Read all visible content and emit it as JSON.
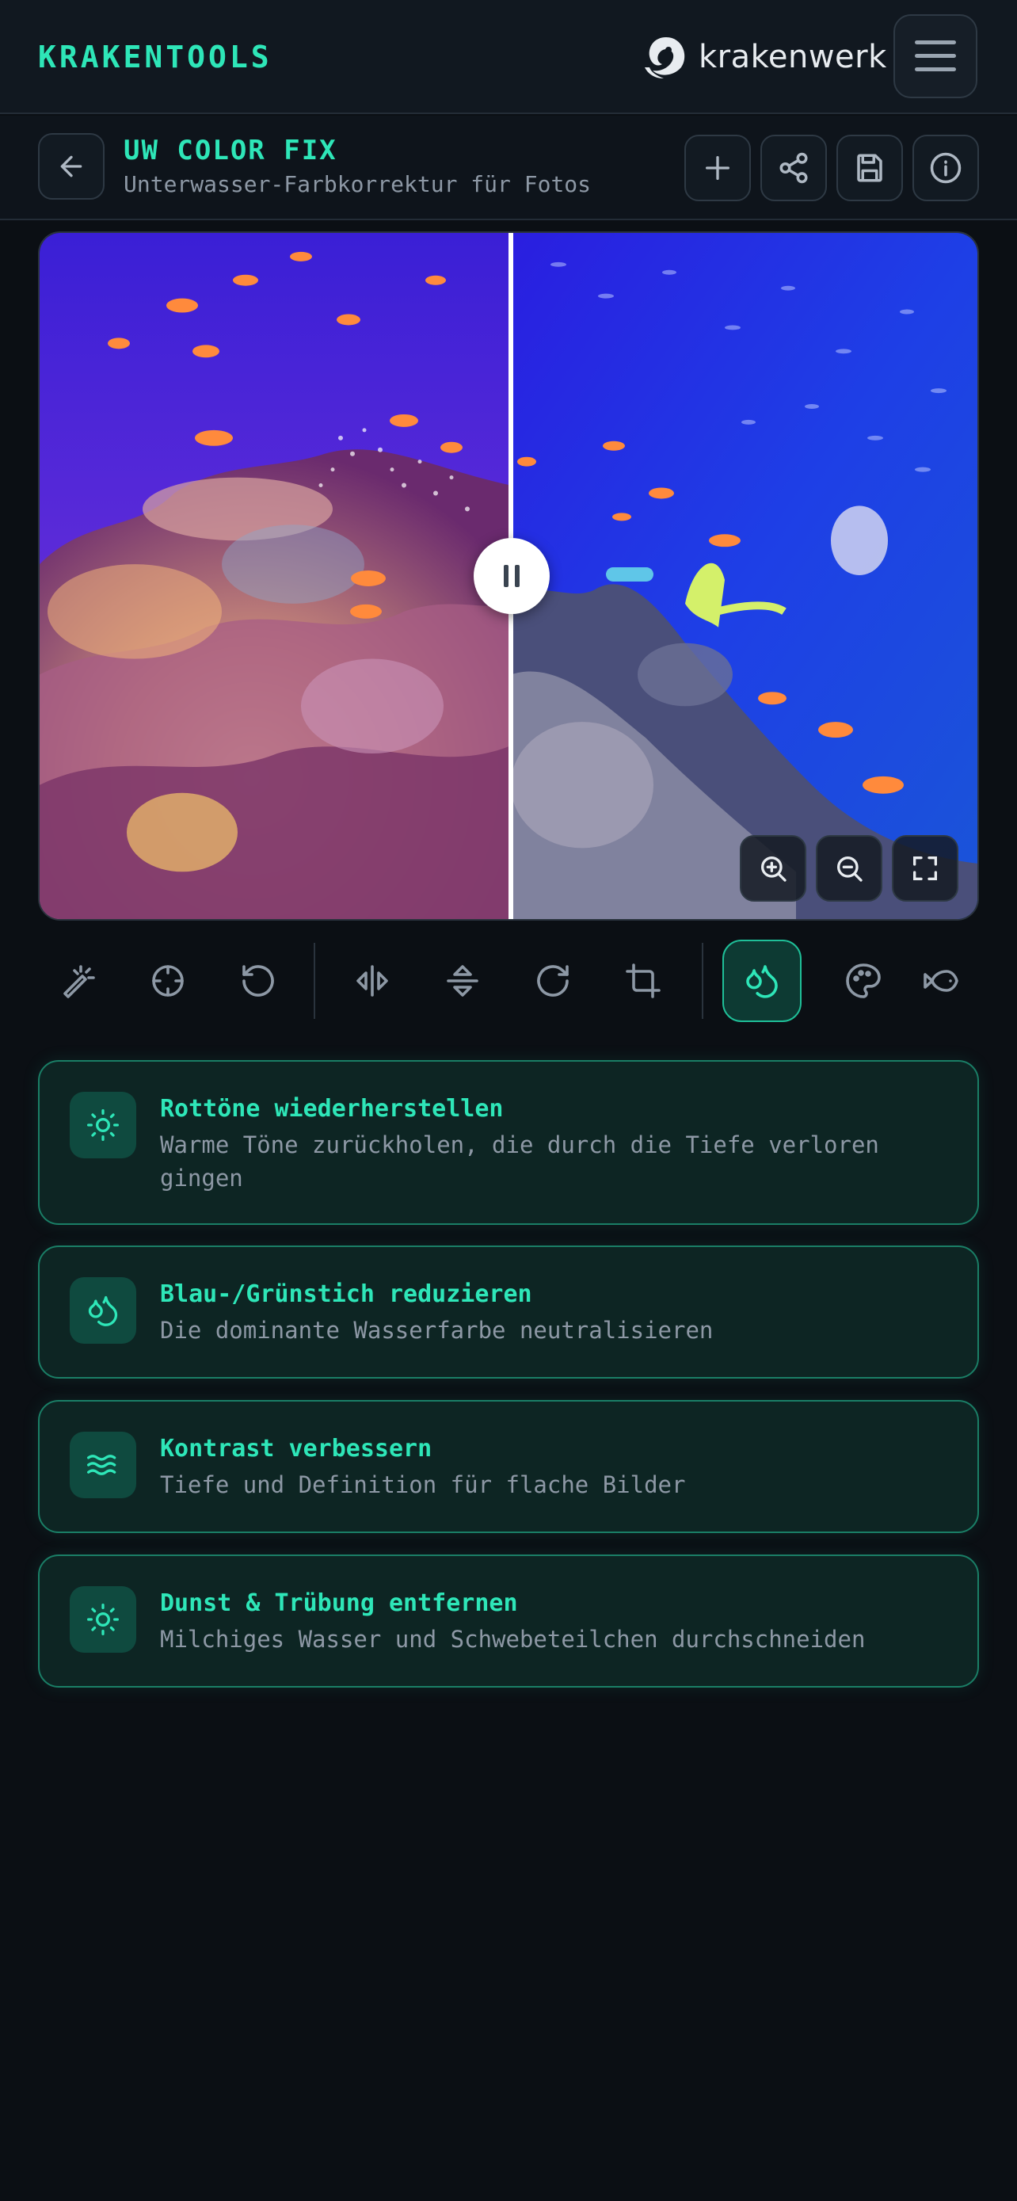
{
  "header": {
    "brand": "KRAKENTOOLS",
    "partner_logo_text": "krakenwerk",
    "menu_icon": "hamburger-icon"
  },
  "tool": {
    "title": "UW COLOR FIX",
    "subtitle": "Unterwasser-Farbkorrektur für Fotos",
    "actions": [
      "plus-icon",
      "share-icon",
      "save-icon",
      "info-icon"
    ]
  },
  "viewer": {
    "compare_handle_icon": "pause-icon",
    "zoom_controls": [
      "zoom-in-icon",
      "zoom-out-icon",
      "fullscreen-icon"
    ]
  },
  "toolbar": {
    "icons": [
      "magic-wand-icon",
      "crosshair-icon",
      "undo-icon",
      "flip-horizontal-icon",
      "flip-vertical-icon",
      "rotate-icon",
      "crop-icon",
      "droplets-icon",
      "palette-icon",
      "fish-icon"
    ],
    "active": "droplets-icon"
  },
  "options": [
    {
      "icon": "sun-icon",
      "title": "Rottöne wiederherstellen",
      "desc": "Warme Töne zurückholen, die durch die Tiefe verloren gingen"
    },
    {
      "icon": "droplets-icon",
      "title": "Blau-/Grünstich reduzieren",
      "desc": "Die dominante Wasserfarbe neutralisieren"
    },
    {
      "icon": "waves-icon",
      "title": "Kontrast verbessern",
      "desc": "Tiefe und Definition für flache Bilder"
    },
    {
      "icon": "sun-icon",
      "title": "Dunst & Trübung entfernen",
      "desc": "Milchiges Wasser und Schwebeteilchen durchschneiden"
    }
  ],
  "colors": {
    "accent": "#2ee6b8",
    "card_border": "#1a7e66",
    "background": "#0b0f14"
  }
}
